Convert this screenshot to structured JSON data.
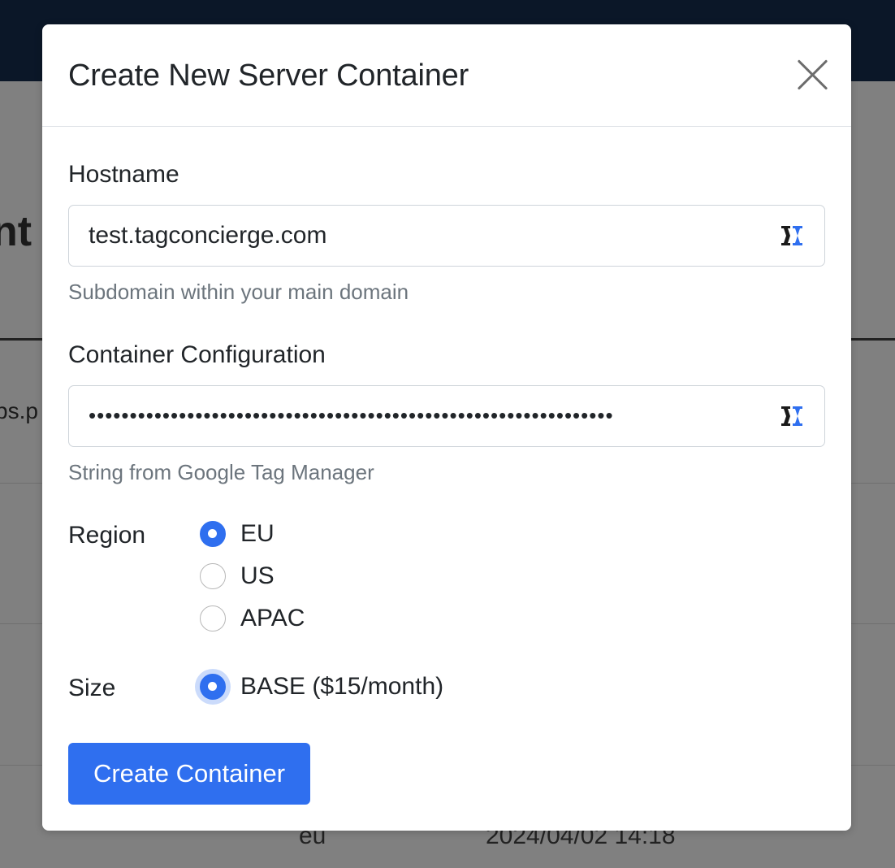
{
  "background": {
    "heading_fragment": "nt",
    "cell_fragment": "ps.p",
    "row_region": "eu",
    "row_timestamp": "2024/04/02 14:18"
  },
  "modal": {
    "title": "Create New Server Container",
    "close_icon": "close-icon",
    "hostname": {
      "label": "Hostname",
      "value": "test.tagconcierge.com",
      "help": "Subdomain within your main domain"
    },
    "config": {
      "label": "Container Configuration",
      "value": "••••••••••••••••••••••••••••••••••••••••••••••••••••••••••••••••",
      "help": "String from Google Tag Manager"
    },
    "region": {
      "label": "Region",
      "options": [
        "EU",
        "US",
        "APAC"
      ],
      "selected": "EU"
    },
    "size": {
      "label": "Size",
      "options": [
        "BASE ($15/month)"
      ],
      "selected": "BASE ($15/month)"
    },
    "submit_label": "Create Container"
  },
  "colors": {
    "primary": "#2f6fef",
    "topbar": "#0b1728",
    "help_text": "#6c757d"
  }
}
